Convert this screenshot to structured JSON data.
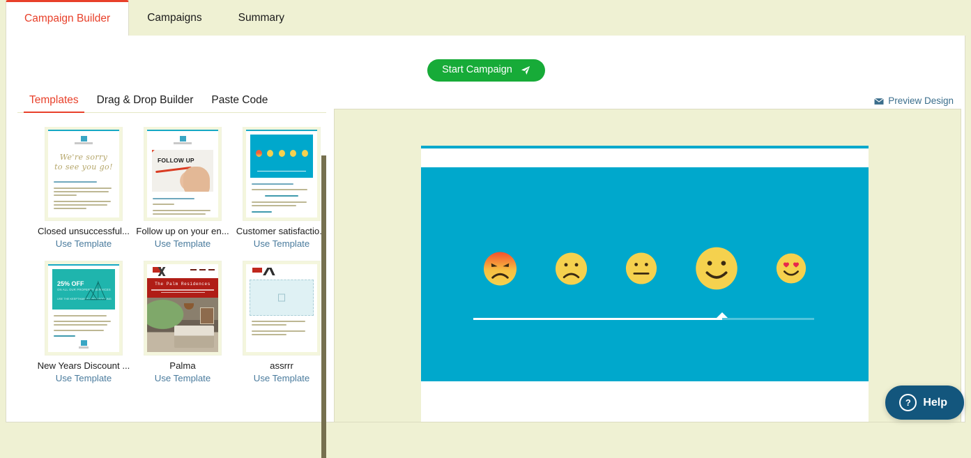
{
  "top_tabs": [
    {
      "label": "Campaign Builder",
      "active": true
    },
    {
      "label": "Campaigns",
      "active": false
    },
    {
      "label": "Summary",
      "active": false
    }
  ],
  "toolbar": {
    "start_campaign_label": "Start Campaign",
    "send_icon": "send-icon"
  },
  "builder_tabs": [
    {
      "label": "Templates",
      "active": true
    },
    {
      "label": "Drag & Drop Builder",
      "active": false
    },
    {
      "label": "Paste Code",
      "active": false
    }
  ],
  "preview_link": {
    "label": "Preview Design",
    "icon": "mail-icon"
  },
  "templates": {
    "use_template_label": "Use Template",
    "items": [
      {
        "title": "Closed unsuccessful...",
        "thumb": "closed-unsuccessful"
      },
      {
        "title": "Follow up on your en...",
        "thumb": "follow-up"
      },
      {
        "title": "Customer satisfactio...",
        "thumb": "customer-satisfaction"
      },
      {
        "title": "New Years Discount ...",
        "thumb": "new-years-discount"
      },
      {
        "title": "Palma",
        "thumb": "palma"
      },
      {
        "title": "assrrr",
        "thumb": "assrrr"
      }
    ]
  },
  "thumbnails": {
    "closed_unsuccessful": {
      "script_line1": "We're sorry",
      "script_line2": "to see you go!"
    },
    "follow_up": {
      "headline": "FOLLOW UP"
    },
    "new_years": {
      "headline": "25% OFF",
      "subhead": "ON ALL OUR PROPERTY SERVICES",
      "code": "USE THE KEEPTHANKS UPON BOOKING"
    },
    "palma": {
      "title": "The Palm Residences"
    }
  },
  "email_preview": {
    "emojis": [
      {
        "name": "angry-emoji",
        "mood": "angry"
      },
      {
        "name": "sad-emoji",
        "mood": "sad"
      },
      {
        "name": "neutral-emoji",
        "mood": "neutral"
      },
      {
        "name": "happy-emoji",
        "mood": "happy"
      },
      {
        "name": "love-emoji",
        "mood": "love"
      }
    ],
    "slider_position_percent": 73
  },
  "help": {
    "label": "Help",
    "icon": "question-circle-icon"
  },
  "colors": {
    "accent_red": "#e8402a",
    "page_bg": "#eff1d3",
    "green": "#17ab38",
    "hero_blue": "#00a8cc",
    "link_blue": "#4a7b9d",
    "help_blue": "#13567d",
    "emoji_yellow": "#f5d14e"
  }
}
